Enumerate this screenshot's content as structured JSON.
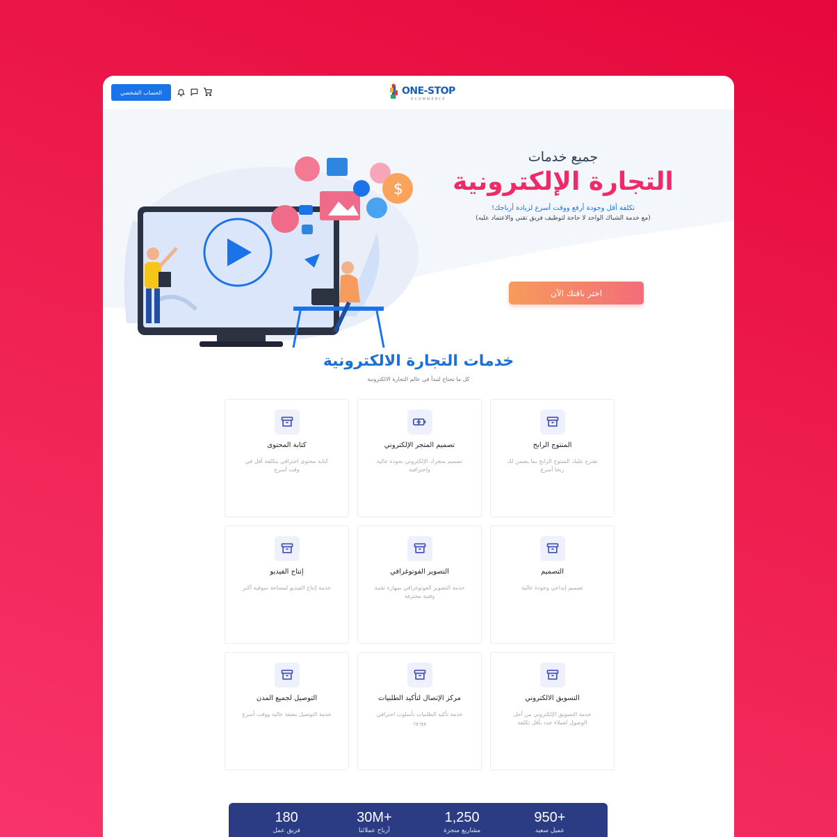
{
  "header": {
    "account_label": "الحساب الشخصي",
    "logo_text": "ONE-STOP",
    "logo_sub": "ECOMMERCE",
    "icons": [
      "cart-icon",
      "chat-icon",
      "bell-icon"
    ]
  },
  "hero": {
    "subtitle": "جميع خدمات",
    "title": "التجارة الإلكترونية",
    "desc1": "تكلفة أقل وجودة أرفع ووقت أسرع لزيادة أرباحك!",
    "desc2": "(مع خدمة الشباك الواحد لا حاجة لتوظيف فريق تقني والاعتماد عليه)",
    "cta": "اختر باقتك الآن"
  },
  "services": {
    "title": "خدمات التجارة الالكترونية",
    "subtitle": "كل ما تحتاج لتبدأ في عالم التجارة الالكترونية",
    "cards": [
      {
        "title": "المنتوج الرابح",
        "desc": "نقترح عليك المنتوج الرابح بما يضمن لك ربحا أسرع",
        "icon": "box-icon"
      },
      {
        "title": "تصميم المتجر الإلكتروني",
        "desc": "تصميم متجرك الإلكتروني بجودة عالية واحترافية",
        "icon": "battery-charge-icon"
      },
      {
        "title": "كتابة المحتوى",
        "desc": "كتابة محتوى احترافي بتكلفة أقل في وقت أسرع",
        "icon": "box-icon"
      },
      {
        "title": "التصميم",
        "desc": "تصميم إبداعي وجودة عالية",
        "icon": "box-icon"
      },
      {
        "title": "التصوير الفوتوغرافي",
        "desc": "خدمة التصوير الفوتوغرافي بمهارة تقنية وفنية محترفة",
        "icon": "box-icon"
      },
      {
        "title": "إنتاج الفيديو",
        "desc": "خدمة إنتاج الفيديو لمساحة سوقية أكبر",
        "icon": "box-icon"
      },
      {
        "title": "التسويق الالكتروني",
        "desc": "خدمة التسويق الإلكتروني من أجل الوصول لعملاء جدد بأقل تكلفة",
        "icon": "box-icon"
      },
      {
        "title": "مركز الإتصال لتأكيد الطلبيات",
        "desc": "خدمة تأكيد الطلبيات بأسلوب احترافي وودود",
        "icon": "box-icon"
      },
      {
        "title": "التوصيل لجميع المدن",
        "desc": "خدمة التوصيل بصفة عالية ووقت أسرع",
        "icon": "box-icon"
      }
    ]
  },
  "stats": [
    {
      "num": "950+",
      "label": "عميل سعيد"
    },
    {
      "num": "1,250",
      "label": "مشاريع منجزة"
    },
    {
      "num": "30M+",
      "label": "أرباح عملائنا"
    },
    {
      "num": "180",
      "label": "فريق عمل"
    }
  ],
  "colors": {
    "accent": "#1a73e8",
    "hero_title": "#ee2b68",
    "stats_bg": "#2c3c84"
  }
}
